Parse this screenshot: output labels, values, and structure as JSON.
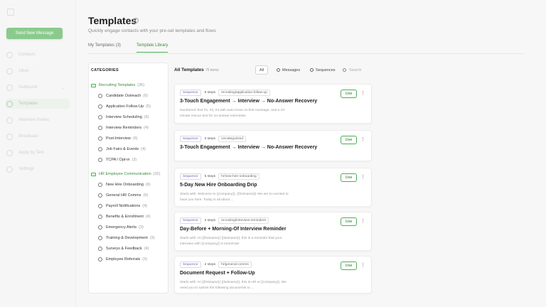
{
  "sidebar": {
    "send_label": "Send New Message",
    "items": [
      {
        "label": "Contacts",
        "icon": "contacts-icon"
      },
      {
        "label": "Inbox",
        "icon": "inbox-icon"
      },
      {
        "label": "Outbound",
        "icon": "outbound-icon"
      },
      {
        "label": "Templates",
        "icon": "templates-icon"
      },
      {
        "label": "Interview Invites",
        "icon": "calendar-icon"
      },
      {
        "label": "Broadcast",
        "icon": "broadcast-icon"
      },
      {
        "label": "Apply by Text",
        "icon": "phone-icon"
      },
      {
        "label": "Settings",
        "icon": "gear-icon"
      }
    ]
  },
  "header": {
    "title": "Templates",
    "subtitle": "Quickly engage contacts with your pre-set templates and flows"
  },
  "tabs": [
    {
      "label": "My Templates (3)"
    },
    {
      "label": "Template Library"
    }
  ],
  "categories": {
    "heading": "CATEGORIES",
    "groups": [
      {
        "label": "Recruiting Templates",
        "count": "(35)",
        "items": [
          {
            "label": "Candidate Outreach",
            "count": "(6)"
          },
          {
            "label": "Application Follow-Up",
            "count": "(5)"
          },
          {
            "label": "Interview Scheduling",
            "count": "(6)"
          },
          {
            "label": "Interview Reminders",
            "count": "(4)"
          },
          {
            "label": "Post-Interview",
            "count": "(6)"
          },
          {
            "label": "Job Fairs & Events",
            "count": "(4)"
          },
          {
            "label": "TCPA / Opt-in",
            "count": "(3)"
          }
        ]
      },
      {
        "label": "HR Employee Communication",
        "count": "(32)",
        "items": [
          {
            "label": "New Hire Onboarding",
            "count": "(6)"
          },
          {
            "label": "General HR Comms",
            "count": "(5)"
          },
          {
            "label": "Payroll Notifications",
            "count": "(4)"
          },
          {
            "label": "Benefits & Enrollment",
            "count": "(4)"
          },
          {
            "label": "Emergency Alerts",
            "count": "(3)"
          },
          {
            "label": "Training & Development",
            "count": "(3)"
          },
          {
            "label": "Surveys & Feedback",
            "count": "(4)"
          },
          {
            "label": "Employee Referrals",
            "count": "(3)"
          }
        ]
      }
    ]
  },
  "list": {
    "title": "All Templates",
    "count": "76 items",
    "filters": {
      "all": "All",
      "messages": "Messages",
      "sequences": "Sequences"
    },
    "search_placeholder": "Search"
  },
  "cards": [
    {
      "type": "Sequence",
      "steps": "5 steps",
      "tag": "recruiting/application-follow-up",
      "title": "3-Touch Engagement → Interview → No-Answer Recovery",
      "desc": "Numbered Text #1, #2, #3 with auto-move on first message, and a 10-minute rescue text for no-answer interviews",
      "use": "Use"
    },
    {
      "type": "Sequence",
      "steps": "0 steps",
      "tag": "Uncategorized",
      "title": "3-Touch Engagement → Interview → No-Answer Recovery",
      "desc": "",
      "use": "Use"
    },
    {
      "type": "Sequence",
      "steps": "5 steps",
      "tag": "hr/new-hire-onboarding",
      "title": "5-Day New Hire Onboarding Drip",
      "desc": "Starts with: Welcome to {{company}}, {{firstname}}! We are so excited to have you here. Today is all about ...",
      "use": "Use"
    },
    {
      "type": "Sequence",
      "steps": "2 steps",
      "tag": "recruiting/interview-reminders",
      "title": "Day-Before + Morning-Of Interview Reminder",
      "desc": "Starts with: Hi {{firstname}} {{lastname}}, this is a reminder that your interview with {{company}} is tomorrow!",
      "use": "Use"
    },
    {
      "type": "Sequence",
      "steps": "2 steps",
      "tag": "hr/general-comms",
      "title": "Document Request + Follow-Up",
      "desc": "Starts with: Hi {{firstname}} {{lastname}}, this is HR at {{company}}. We need you to submit the following documents to ...",
      "use": "Use"
    }
  ],
  "colors": {
    "accent": "#4caf50",
    "accent_text": "#3d8b40",
    "sequence_pill": "#6b5fb5"
  }
}
